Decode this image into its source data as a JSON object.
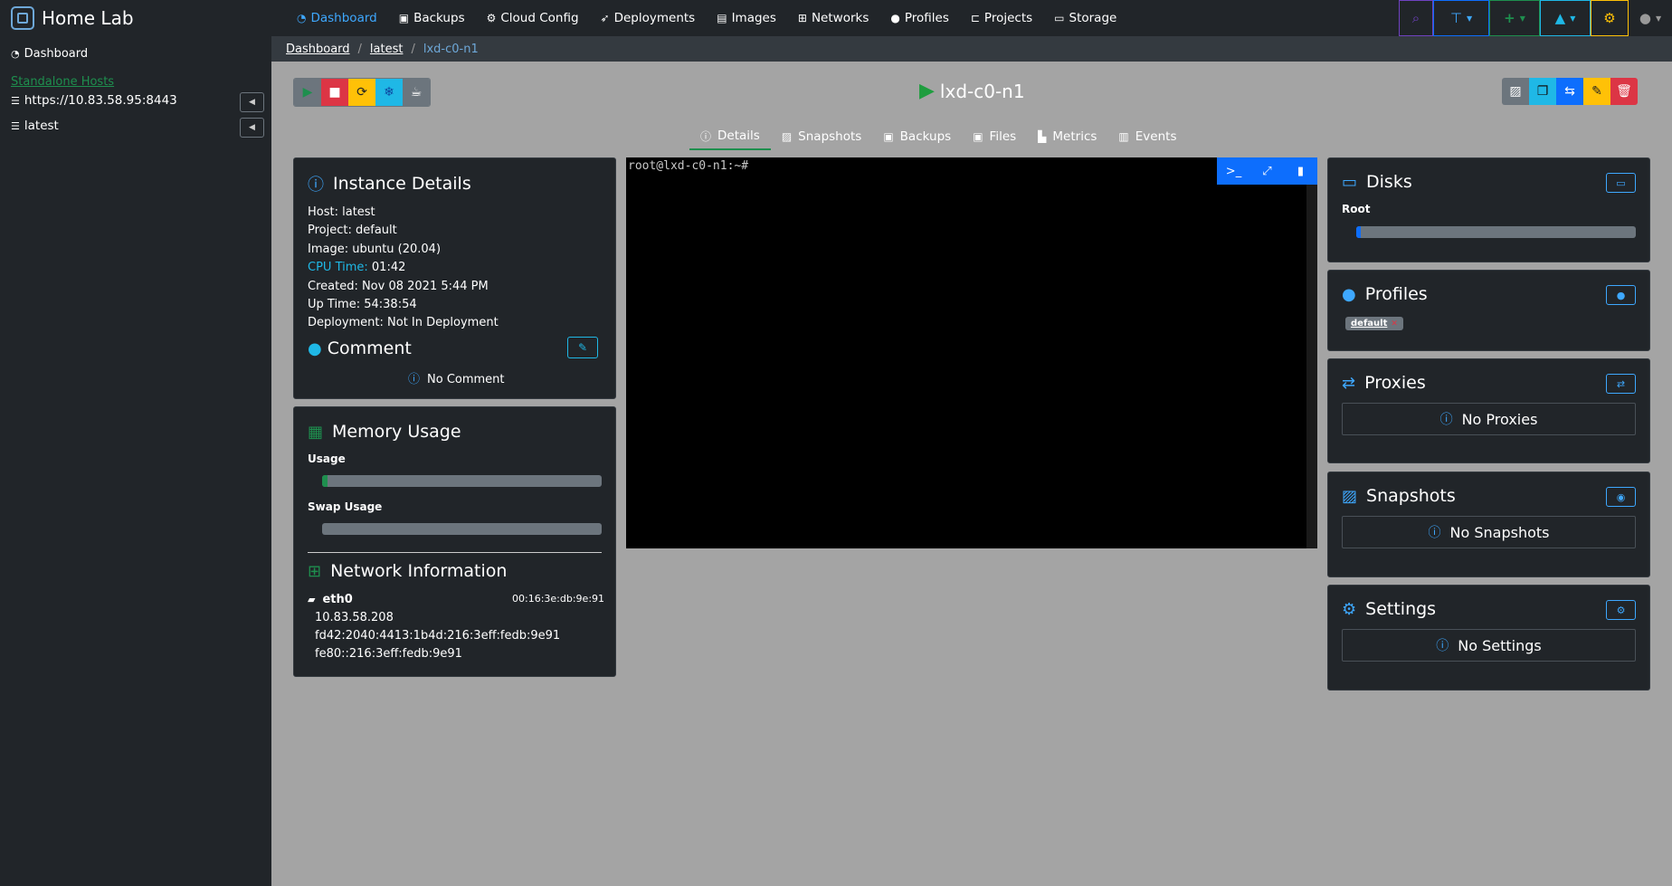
{
  "app": {
    "title": "Home Lab"
  },
  "nav": {
    "items": [
      {
        "label": "Dashboard",
        "icon": "tachometer-icon"
      },
      {
        "label": "Backups",
        "icon": "floppy-icon"
      },
      {
        "label": "Cloud Config",
        "icon": "gears-icon"
      },
      {
        "label": "Deployments",
        "icon": "rocket-icon"
      },
      {
        "label": "Images",
        "icon": "images-icon"
      },
      {
        "label": "Networks",
        "icon": "network-icon"
      },
      {
        "label": "Profiles",
        "icon": "users-icon"
      },
      {
        "label": "Projects",
        "icon": "project-diagram-icon"
      },
      {
        "label": "Storage",
        "icon": "hdd-icon"
      }
    ]
  },
  "sidebar": {
    "dashboard": "Dashboard",
    "section": "Standalone Hosts",
    "hosts": [
      "https://10.83.58.95:8443",
      "latest"
    ]
  },
  "breadcrumb": {
    "items": [
      "Dashboard",
      "latest"
    ],
    "active": "lxd-c0-n1"
  },
  "instance": {
    "name": "lxd-c0-n1"
  },
  "tabs": [
    "Details",
    "Snapshots",
    "Backups",
    "Files",
    "Metrics",
    "Events"
  ],
  "details": {
    "title": "Instance Details",
    "host": "Host: latest",
    "project": "Project: default",
    "image": "Image: ubuntu (20.04)",
    "cpu_label": "CPU Time:",
    "cpu_value": "01:42",
    "created": "Created: Nov 08 2021 5:44 PM",
    "uptime": "Up Time: 54:38:54",
    "deployment": "Deployment: Not In Deployment",
    "comment_title": "Comment",
    "comment_empty": "No Comment"
  },
  "memory": {
    "title": "Memory Usage",
    "usage_label": "Usage",
    "usage_fraction": 0.02,
    "swap_label": "Swap Usage",
    "swap_fraction": 0.0,
    "network_title": "Network Information",
    "iface": "eth0",
    "mac": "00:16:3e:db:9e:91",
    "addresses": [
      "10.83.58.208",
      "fd42:2040:4413:1b4d:216:3eff:fedb:9e91",
      "fe80::216:3eff:fedb:9e91"
    ]
  },
  "terminal": {
    "prompt": "root@lxd-c0-n1:~#"
  },
  "disks": {
    "title": "Disks",
    "root_label": "Root",
    "root_fraction": 0.01
  },
  "profiles": {
    "title": "Profiles",
    "badge": "default"
  },
  "proxies": {
    "title": "Proxies",
    "empty": "No Proxies"
  },
  "snapshots": {
    "title": "Snapshots",
    "empty": "No Snapshots"
  },
  "settings": {
    "title": "Settings",
    "empty": "No Settings"
  },
  "colors": {
    "green": "#1e8f4e",
    "blue": "#0d6efd",
    "cyan": "#1fb8e6",
    "yellow": "#ffc107",
    "red": "#dc3545",
    "dark": "#212529"
  }
}
